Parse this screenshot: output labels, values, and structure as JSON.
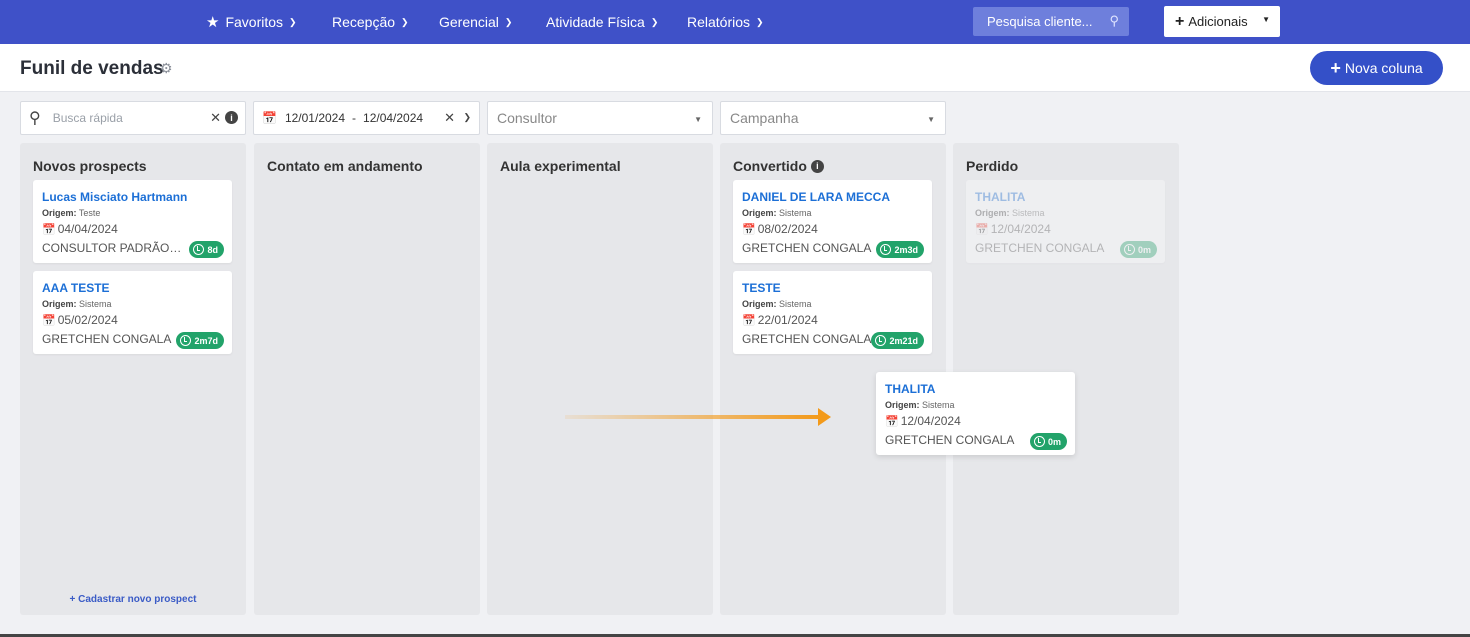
{
  "nav": {
    "items": [
      {
        "label": "Favoritos"
      },
      {
        "label": "Recepção"
      },
      {
        "label": "Gerencial"
      },
      {
        "label": "Atividade Física"
      },
      {
        "label": "Relatórios"
      }
    ],
    "search_placeholder": "Pesquisa cliente...",
    "add_button": "Adicionais"
  },
  "header": {
    "title": "Funil de vendas",
    "new_column_button": "Nova coluna"
  },
  "filters": {
    "search_placeholder": "Busca rápida",
    "date_start": "12/01/2024",
    "date_sep": "-",
    "date_end": "12/04/2024",
    "consultor_placeholder": "Consultor",
    "campanha_placeholder": "Campanha"
  },
  "columns": [
    {
      "title": "Novos prospects",
      "add_link": "Cadastrar novo prospect"
    },
    {
      "title": "Contato em andamento"
    },
    {
      "title": "Aula experimental"
    },
    {
      "title": "Convertido"
    },
    {
      "title": "Perdido"
    }
  ],
  "cards": {
    "c1": {
      "name": "Lucas Misciato Hartmann",
      "origin_label": "Origem:",
      "origin": "Teste",
      "date": "04/04/2024",
      "consultor": "CONSULTOR PADRÃO - BRASIL",
      "time": "8d"
    },
    "c2": {
      "name": "AAA TESTE",
      "origin_label": "Origem:",
      "origin": "Sistema",
      "date": "05/02/2024",
      "consultor": "GRETCHEN CONGALA",
      "time": "2m7d"
    },
    "c3": {
      "name": "DANIEL DE LARA MECCA",
      "origin_label": "Origem:",
      "origin": "Sistema",
      "date": "08/02/2024",
      "consultor": "GRETCHEN CONGALA",
      "time": "2m3d"
    },
    "c4": {
      "name": "TESTE",
      "origin_label": "Origem:",
      "origin": "Sistema",
      "date": "22/01/2024",
      "consultor": "GRETCHEN CONGALA",
      "time": "2m21d"
    },
    "c5": {
      "name": "THALITA",
      "origin_label": "Origem:",
      "origin": "Sistema",
      "date": "12/04/2024",
      "consultor": "GRETCHEN CONGALA",
      "time": "0m"
    },
    "c6": {
      "name": "THALITA",
      "origin_label": "Origem:",
      "origin": "Sistema",
      "date": "12/04/2024",
      "consultor": "GRETCHEN CONGALA",
      "time": "0m"
    }
  },
  "colors": {
    "nav_bg": "#3f51c8",
    "accent": "#3450c8",
    "badge": "#22a36a",
    "arrow": "#f39a1a"
  }
}
